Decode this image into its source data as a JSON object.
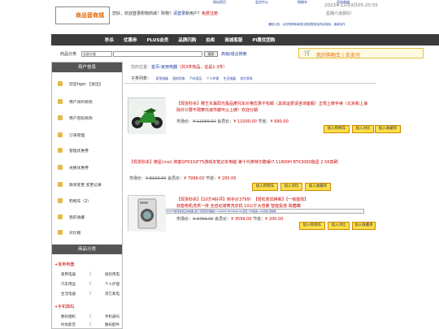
{
  "top": {
    "links": [
      "网站首页",
      "会员中心",
      "购物车",
      "手机商城"
    ],
    "logo_text": "商品营商城",
    "welcome_prefix": "您好，欢迎登录购物商城！购物？",
    "login_link": "请登录",
    "new_user_text": "新用户？",
    "register_link": "免费注册",
    "datetime": "2023年12月9日05:20:55",
    "weekday": "星期六凌晨好!",
    "notice": "通知公告：点击购物商城请注册或登录后购买商品，谢谢合作"
  },
  "nav": {
    "items": [
      "秒杀",
      "优惠券",
      "PLUS会员",
      "品牌闪购",
      "拍卖",
      "商城客服",
      "PI惠优团购"
    ]
  },
  "search": {
    "label": "商品分类",
    "category_value": "全部分类",
    "button": "搜索",
    "advanced": "高级|组合搜索"
  },
  "cart": {
    "icon": "cart-icon",
    "text": "我的购物车 | 去支付"
  },
  "sidebar": {
    "user_header": "用户信息",
    "items": [
      {
        "icon": "user-icon",
        "label": "欢迎tiger 【退出】"
      },
      {
        "icon": "profile-icon",
        "label": "用户资料修改"
      },
      {
        "icon": "lock-icon",
        "label": "用户密码修改"
      },
      {
        "icon": "order-icon",
        "label": "订单管理"
      },
      {
        "icon": "coupon-icon",
        "label": "管理优惠券"
      },
      {
        "icon": "ticket-icon",
        "label": "兑换优惠券"
      },
      {
        "icon": "recharge-icon",
        "label": "款资变更 变更记录"
      },
      {
        "icon": "cart-icon",
        "label": "购物车（2）"
      },
      {
        "icon": "favorite-icon",
        "label": "我的收藏"
      },
      {
        "icon": "compare-icon",
        "label": "对比框"
      }
    ],
    "category_header": "商品分类",
    "groups": [
      {
        "title": "+家用电器",
        "rows": [
          [
            "家用电器",
            "厨房用电"
          ],
          [
            "汽车用品",
            "个人护理"
          ],
          [
            "生活电器",
            "其它家电"
          ]
        ]
      },
      {
        "title": "+手机数码",
        "rows": [
          [
            "数码相机",
            "手机通讯"
          ],
          [
            "时尚影音",
            "数码配件"
          ]
        ]
      }
    ]
  },
  "main": {
    "breadcrumb_prefix": "您的位置：",
    "breadcrumb_home": "首页",
    "breadcrumb_sep": "›",
    "breadcrumb_cat": "家用电器",
    "breadcrumb_count": "（共3件商品，这是1-3件）",
    "subtype_label": "子类列表：",
    "subtypes": [
      "家用电器",
      "厨房用电",
      "汽车用品",
      "个人护理",
      "生活电器",
      "其它家电"
    ],
    "products": [
      {
        "title": "【现货秒杀】狮王东瀛阳光极品摩托车价格优惠不包邮（具体运费请咨询客服）正规上牌手续（北京和上海除外只要不限摩托城市都可以上牌）欢迎分期",
        "market_label": "市场价：",
        "market_price": "¥ 11680.00",
        "member_label": "会员价：",
        "member_price": "¥ 11000.00",
        "save_label": "节省：",
        "save_price": "¥ 680.00",
        "thumb": "motorcycle"
      },
      {
        "title": "【现货秒杀】微星(msi) 侠客GF63/GF75游戏本笔记本电脑 第十代英特尔酷睿i7-11800H RTX3060独显 2.5K高刷",
        "market_label": "市场价：",
        "market_price": "¥ 8199.00",
        "member_label": "会员价：",
        "member_price": "¥ 7999.00",
        "save_label": "节省：",
        "save_price": "¥ 200.00",
        "thumb": "laptop"
      },
      {
        "title": "【现货秒杀】【10万4好评】到手价3799！【轻松变旧换新】【一级能效】双能电机洗烘一体 全自动滚筒洗衣机 10公斤大容量 智能投放 除菌螨",
        "market_label": "市场价：",
        "market_price": "¥ 3799.00",
        "member_label": "会员价：",
        "member_price": "¥ 3599.00",
        "save_label": "节省：",
        "save_price": "¥ 200.00",
        "thumb": "washer"
      }
    ],
    "btn_cart": "加入购物车",
    "btn_compare": "加入对比",
    "btn_fav": "加入收藏夹",
    "brand_strip": "【特荐推荐】微星(msi) 侠客GF63/GF75游戏本笔记本电脑 第十代英特尔酷睿i7-11800H RTX3060 8G显存 1TB固态+2K高刷 定制版"
  }
}
